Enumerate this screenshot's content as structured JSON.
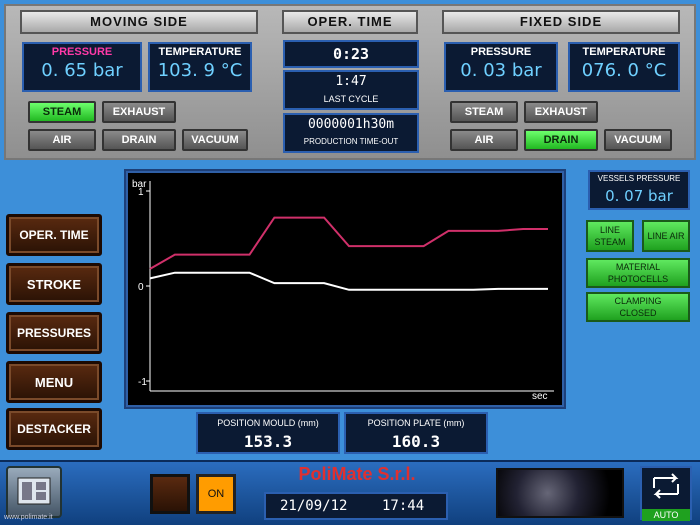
{
  "moving_side": {
    "title": "MOVING SIDE",
    "pressure_label": "PRESSURE",
    "pressure_value": "0. 65 bar",
    "temperature_label": "TEMPERATURE",
    "temperature_value": "103. 9 °C",
    "buttons": [
      "STEAM",
      "EXHAUST",
      "AIR",
      "DRAIN",
      "VACUUM"
    ]
  },
  "oper_time": {
    "title": "OPER. TIME",
    "current": "0:23",
    "last_cycle_value": "1:47",
    "last_cycle_label": "LAST CYCLE",
    "production_value": "0000001h30m",
    "production_label": "PRODUCTION TIME-OUT"
  },
  "fixed_side": {
    "title": "FIXED SIDE",
    "pressure_label": "PRESSURE",
    "pressure_value": "0. 03 bar",
    "temperature_label": "TEMPERATURE",
    "temperature_value": "076. 0 °C",
    "buttons": [
      "STEAM",
      "EXHAUST",
      "AIR",
      "DRAIN",
      "VACUUM"
    ]
  },
  "nav": [
    "OPER. TIME",
    "STROKE",
    "PRESSURES",
    "MENU",
    "DESTACKER"
  ],
  "vessels": {
    "label": "VESSELS PRESSURE",
    "value": "0. 07 bar"
  },
  "status_buttons": {
    "line_steam": "LINE STEAM",
    "line_air": "LINE AIR",
    "material": "MATERIAL PHOTOCELLS",
    "clamping": "CLAMPING CLOSED"
  },
  "chart_data": {
    "type": "line",
    "ylabel": "bar",
    "xlabel": "sec",
    "yticks": [
      "1",
      "0",
      "-1"
    ],
    "ylim": [
      -1,
      1
    ],
    "x": [
      0,
      1,
      2,
      3,
      4,
      5,
      6,
      7,
      8,
      9,
      10,
      11,
      12,
      13,
      14,
      15,
      16
    ],
    "series": [
      {
        "color": "#d0306a",
        "values": [
          0.18,
          0.33,
          0.33,
          0.33,
          0.33,
          0.72,
          0.72,
          0.72,
          0.42,
          0.42,
          0.42,
          0.42,
          0.58,
          0.58,
          0.58,
          0.6,
          0.6
        ]
      },
      {
        "color": "#ffffff",
        "values": [
          0.08,
          0.14,
          0.14,
          0.14,
          0.14,
          0.03,
          0.03,
          0.03,
          -0.04,
          -0.04,
          -0.04,
          -0.04,
          -0.04,
          -0.04,
          -0.03,
          -0.03,
          -0.03
        ]
      }
    ]
  },
  "position_mould": {
    "label": "POSITION MOULD (mm)",
    "value": "153.3"
  },
  "position_plate": {
    "label": "POSITION PLATE (mm)",
    "value": "160.3"
  },
  "footer": {
    "brand": "PoliMate S.r.l.",
    "date": "21/09/12",
    "time": "17:44",
    "on_label": "ON",
    "auto_label": "AUTO",
    "watermark": "www.polimate.it"
  }
}
